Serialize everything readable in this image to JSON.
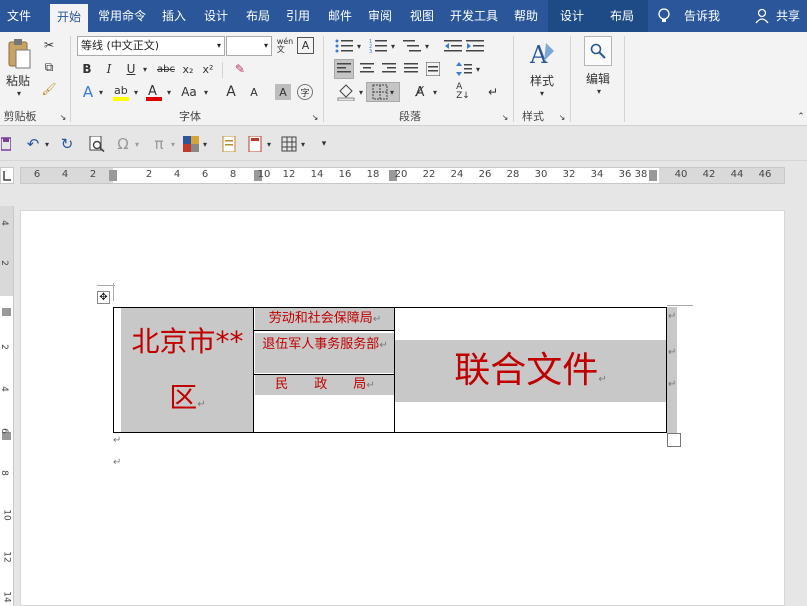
{
  "tabs": [
    {
      "label": "文件",
      "active": false
    },
    {
      "label": "开始",
      "active": true
    },
    {
      "label": "常用命令",
      "active": false
    },
    {
      "label": "插入",
      "active": false
    },
    {
      "label": "设计",
      "active": false
    },
    {
      "label": "布局",
      "active": false
    },
    {
      "label": "引用",
      "active": false
    },
    {
      "label": "邮件",
      "active": false
    },
    {
      "label": "审阅",
      "active": false
    },
    {
      "label": "视图",
      "active": false
    },
    {
      "label": "开发工具",
      "active": false
    },
    {
      "label": "帮助",
      "active": false
    },
    {
      "label": "设计",
      "active": false
    },
    {
      "label": "布局",
      "active": false
    }
  ],
  "tellme": "告诉我",
  "share": "共享",
  "ribbon": {
    "paste_label": "粘贴",
    "clipboard_group": "剪贴板",
    "font_name": "等线 (中文正文)",
    "font_size": "",
    "bold": "B",
    "italic": "I",
    "underline": "U",
    "strike": "abc",
    "subscript": "x₂",
    "superscript": "x²",
    "case_button": "Aa",
    "grow_font": "A",
    "shrink_font": "A",
    "font_group": "字体",
    "paragraph_group": "段落",
    "styles_label": "样式",
    "styles_group": "样式",
    "editing_label": "编辑"
  },
  "ruler": {
    "numbers": [
      "6",
      "4",
      "2",
      "2",
      "4",
      "6",
      "8",
      "10",
      "12",
      "14",
      "16",
      "18",
      "20",
      "22",
      "24",
      "26",
      "28",
      "30",
      "32",
      "34",
      "36",
      "38",
      "40",
      "42",
      "44",
      "46"
    ]
  },
  "vruler": {
    "numbers": [
      "4",
      "2",
      "2",
      "4",
      "6",
      "8",
      "10",
      "12",
      "14"
    ]
  },
  "document": {
    "cell_left": "北京市**区",
    "cell_mid_1": "劳动和社会保障局",
    "cell_mid_2": "退伍军人事务服务部",
    "cell_mid_3": "民　　政　　局",
    "cell_right": "联合文件",
    "paragraph_mark": "↵"
  },
  "colors": {
    "accent": "#2b579a",
    "doc_red": "#c00000",
    "cell_gray": "#c8c8c8"
  }
}
